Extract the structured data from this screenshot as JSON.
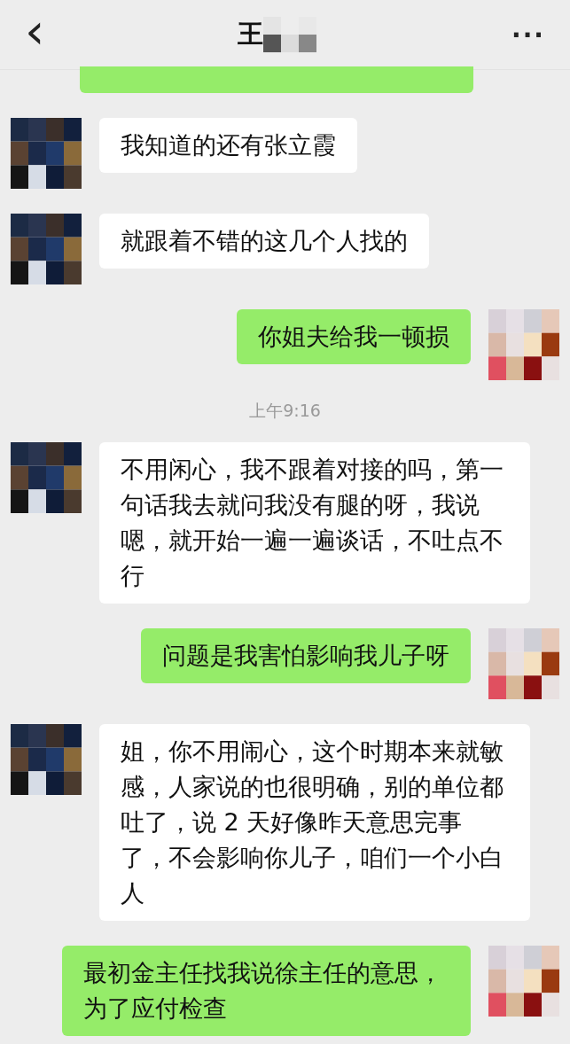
{
  "header": {
    "back": "‹",
    "title": "王",
    "more": "···"
  },
  "messages": [
    {
      "kind": "cut"
    },
    {
      "kind": "received",
      "text": "我知道的还有张立霞"
    },
    {
      "kind": "received",
      "text": "就跟着不错的这几个人找的"
    },
    {
      "kind": "sent",
      "text": "你姐夫给我一顿损"
    },
    {
      "kind": "time",
      "text": "上午9:16"
    },
    {
      "kind": "received",
      "text": "不用闲心，我不跟着对接的吗，第一句话我去就问我没有腿的呀，我说嗯，就开始一遍一遍谈话，不吐点不行"
    },
    {
      "kind": "sent",
      "text": "问题是我害怕影响我儿子呀"
    },
    {
      "kind": "received",
      "text": "姐，你不用闹心，这个时期本来就敏感，人家说的也很明确，别的单位都吐了，说 2 天好像昨天意思完事了，不会影响你儿子，咱们一个小白人"
    },
    {
      "kind": "sent",
      "text": "最初金主任找我说徐主任的意思，为了应付检查"
    }
  ]
}
